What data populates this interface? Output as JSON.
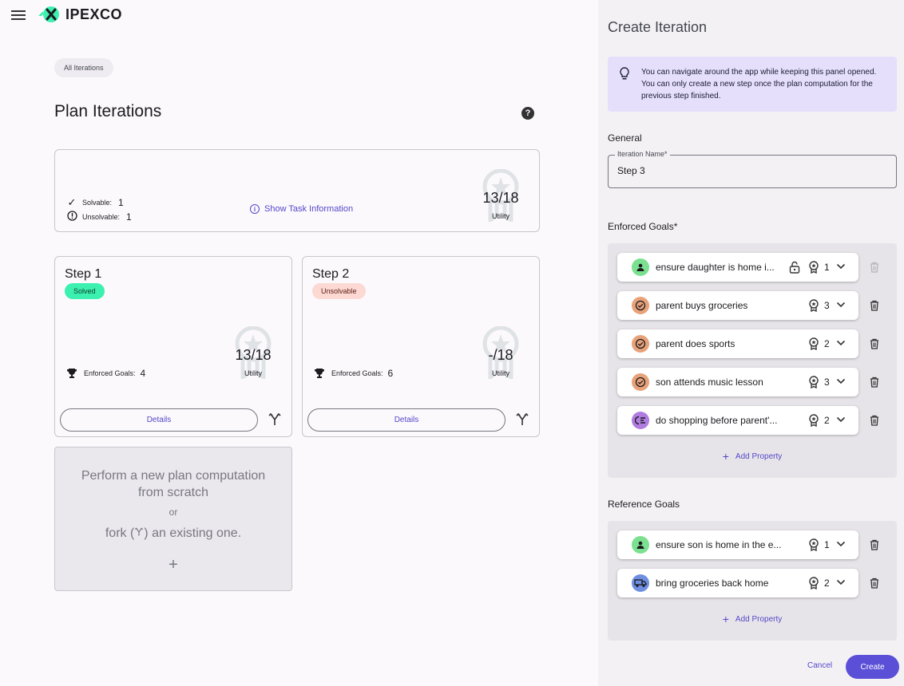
{
  "app": {
    "name": "IPEXCO"
  },
  "breadcrumb": {
    "chip": "All Iterations"
  },
  "page": {
    "title": "Plan Iterations",
    "help": "?"
  },
  "summary": {
    "solvable_label": "Solvable:",
    "solvable_count": "1",
    "unsolvable_label": "Unsolvable:",
    "unsolvable_count": "1",
    "show_task_label": "Show Task Information",
    "utility_value": "13/18",
    "utility_label": "Utility"
  },
  "steps": [
    {
      "title": "Step 1",
      "status": "Solved",
      "enforced_label": "Enforced Goals:",
      "enforced_count": "4",
      "utility_value": "13/18",
      "utility_label": "Utility",
      "details_label": "Details"
    },
    {
      "title": "Step 2",
      "status": "Unsolvable",
      "enforced_label": "Enforced Goals:",
      "enforced_count": "6",
      "utility_value": "-/18",
      "utility_label": "Utility",
      "details_label": "Details"
    }
  ],
  "new_computation": {
    "line1": "Perform a new plan computation from scratch",
    "or": "or",
    "fork_pre": "fork (",
    "fork_post": ") an existing one.",
    "plus": "+"
  },
  "panel": {
    "title": "Create Iteration",
    "info": "You can navigate around the app while keeping this panel opened. You can only create a new step once the plan computation for the previous step finished.",
    "general_label": "General",
    "iteration_name_label": "Iteration Name*",
    "iteration_name_value": "Step 3",
    "enforced_label": "Enforced Goals*",
    "enforced_goals": [
      {
        "name": "ensure daughter is home i...",
        "utility": "1",
        "icon": "person-icon",
        "color": "#7be08f",
        "locked": true
      },
      {
        "name": "parent buys groceries",
        "utility": "3",
        "icon": "check-circle-icon",
        "color": "#e8a27a",
        "locked": false
      },
      {
        "name": "parent does sports",
        "utility": "2",
        "icon": "check-circle-icon",
        "color": "#e8a27a",
        "locked": false
      },
      {
        "name": "son attends music lesson",
        "utility": "3",
        "icon": "check-circle-icon",
        "color": "#e8a27a",
        "locked": false
      },
      {
        "name": "do shopping before parent'...",
        "utility": "2",
        "icon": "sequence-icon",
        "color": "#b07ce0",
        "locked": false
      }
    ],
    "reference_label": "Reference Goals",
    "reference_goals": [
      {
        "name": "ensure son is home in the e...",
        "utility": "1",
        "icon": "person-icon",
        "color": "#7be08f"
      },
      {
        "name": "bring groceries back home",
        "utility": "2",
        "icon": "truck-icon",
        "color": "#6f8fe0"
      }
    ],
    "add_property_label": "Add Property",
    "cancel_label": "Cancel",
    "create_label": "Create"
  }
}
